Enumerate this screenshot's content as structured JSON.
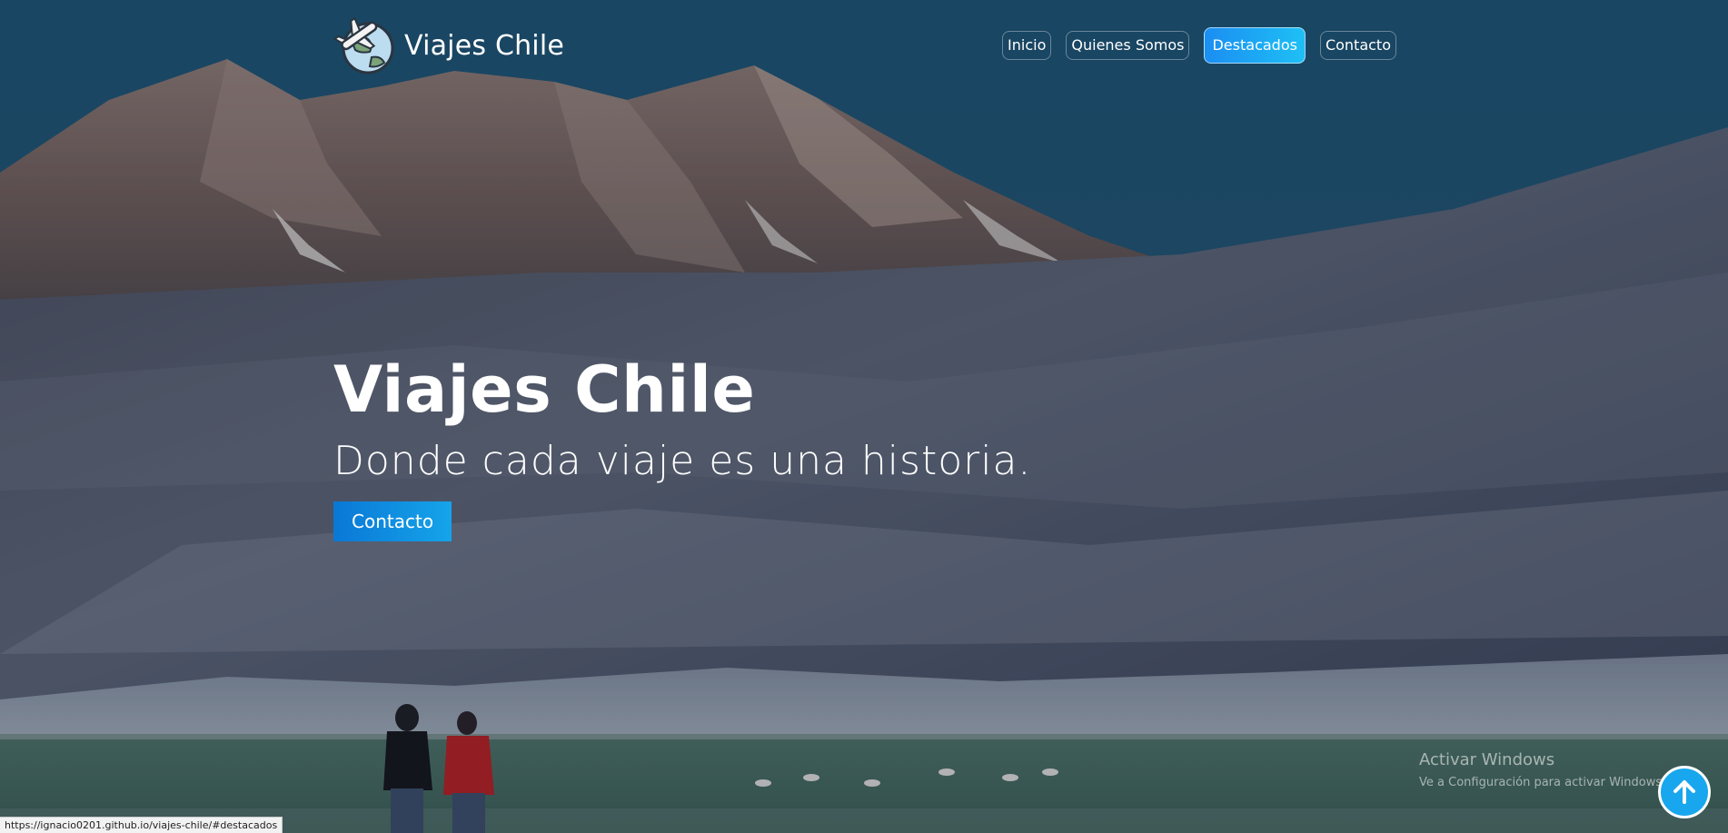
{
  "navbar": {
    "brand_text": "Viajes Chile",
    "links": [
      {
        "label": "Inicio"
      },
      {
        "label": "Quienes Somos"
      },
      {
        "label": "Destacados"
      },
      {
        "label": "Contacto"
      }
    ],
    "active_link": "Destacados"
  },
  "hero": {
    "title": "Viajes Chile",
    "subtitle": "Donde cada viaje es una historia.",
    "button_label": "Contacto"
  },
  "watermark": {
    "title": "Activar Windows",
    "subtitle": "Ve a Configuración para activar Windows."
  },
  "status_bar": {
    "url": "https://ignacio0201.github.io/viajes-chile/#destacados"
  },
  "scroll_top": {
    "icon": "arrow-up-icon"
  },
  "colors": {
    "accent": "#1b8ef2",
    "accent_light": "#1ec0f5",
    "sky": "#1f4a63",
    "text": "#ffffff"
  }
}
